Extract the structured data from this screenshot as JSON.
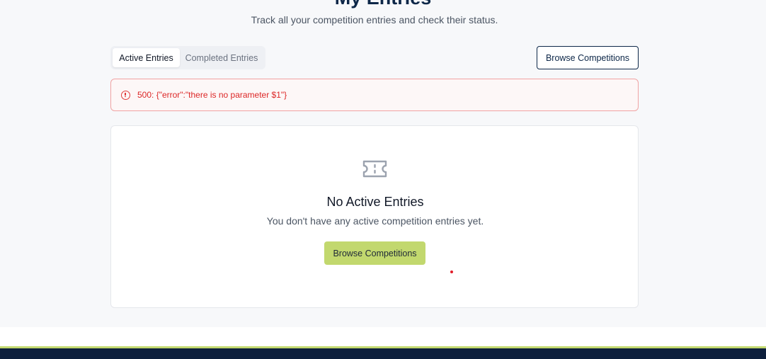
{
  "header": {
    "title": "My Entries",
    "subtitle": "Track all your competition entries and check their status."
  },
  "tabs": [
    {
      "label": "Active Entries",
      "active": true
    },
    {
      "label": "Completed Entries",
      "active": false
    }
  ],
  "actions": {
    "browse_label": "Browse Competitions"
  },
  "error": {
    "icon": "alert-circle-icon",
    "message": "500: {\"error\":\"there is no parameter $1\"}"
  },
  "empty_state": {
    "icon": "ticket-icon",
    "title": "No Active Entries",
    "description": "You don't have any active competition entries yet.",
    "button_label": "Browse Competitions"
  },
  "colors": {
    "brand_navy": "#0d2748",
    "accent_green": "#c2d86e",
    "error_red": "#dc2626",
    "page_background": "#f7f8fa",
    "footer_background": "#0d1f3c"
  }
}
